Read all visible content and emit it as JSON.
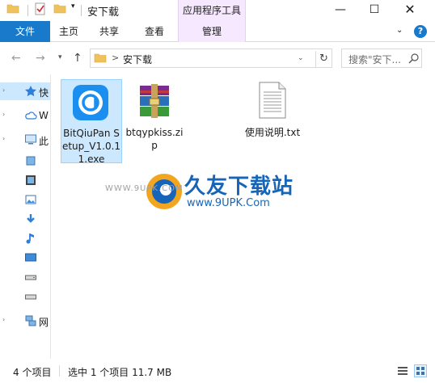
{
  "titlebar": {
    "title": "安下载",
    "context_tab_header": "应用程序工具",
    "minimize": "—",
    "maximize": "☐",
    "close": "✕",
    "quick_access_dropdown": "▾"
  },
  "ribbon": {
    "file": "文件",
    "home": "主页",
    "share": "共享",
    "view": "查看",
    "manage": "管理",
    "expand": "⌄",
    "help": "?"
  },
  "address": {
    "back": "←",
    "forward": "→",
    "recent": "▾",
    "up": "↑",
    "separator": ">",
    "path": "安下载",
    "dropdown": "⌄",
    "refresh": "↻",
    "search_placeholder": "搜索\"安下...",
    "search_icon": "search-icon"
  },
  "sidebar": {
    "items": [
      {
        "label": "快",
        "icon": "star-icon",
        "expander": "›",
        "selected": true
      },
      {
        "label": "W",
        "icon": "cloud-icon",
        "expander": "›",
        "selected": false
      },
      {
        "label": "此",
        "icon": "computer-icon",
        "expander": "›",
        "selected": false
      },
      {
        "label": "",
        "icon": "folder-3d-icon",
        "expander": "",
        "selected": false
      },
      {
        "label": "",
        "icon": "video-icon",
        "expander": "",
        "selected": false
      },
      {
        "label": "",
        "icon": "picture-icon",
        "expander": "",
        "selected": false
      },
      {
        "label": "",
        "icon": "download-icon",
        "expander": "",
        "selected": false
      },
      {
        "label": "",
        "icon": "music-icon",
        "expander": "",
        "selected": false
      },
      {
        "label": "",
        "icon": "desktop-icon",
        "expander": "",
        "selected": false
      },
      {
        "label": "",
        "icon": "drive-icon",
        "expander": "",
        "selected": false
      },
      {
        "label": "",
        "icon": "drive-icon",
        "expander": "",
        "selected": false
      },
      {
        "label": "网",
        "icon": "network-icon",
        "expander": "›",
        "selected": false
      }
    ]
  },
  "files": [
    {
      "name": "BitQiuPan Setup_V1.0.11.exe",
      "icon": "bitqiupan-app-icon",
      "selected": true
    },
    {
      "name": "btqypkiss.zip",
      "icon": "winrar-archive-icon",
      "selected": false
    },
    {
      "name": "使用说明.txt",
      "icon": "text-document-icon",
      "selected": false
    }
  ],
  "watermark": {
    "title": "久友下载站",
    "url": "www.9UPK.Com",
    "www": "WWW.9UPK.COM"
  },
  "status": {
    "count": "4 个项目",
    "selection": "选中 1 个项目  11.7 MB",
    "details_view": "details-view-icon",
    "icons_view": "large-icons-view-icon"
  },
  "colors": {
    "accent": "#1979ca",
    "selection_bg": "#cce8ff",
    "selection_border": "#99d1ff",
    "context_tab_bg": "#f6e9ff",
    "watermark_blue": "#1765b8"
  }
}
